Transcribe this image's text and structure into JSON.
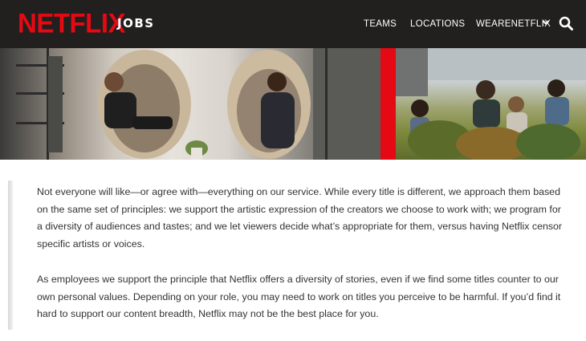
{
  "header": {
    "logo": "NETFLIX",
    "section": "JOBS",
    "nav": {
      "teams": "TEAMS",
      "locations": "LOCATIONS",
      "wearenetflix": "WEARENETFLIX"
    },
    "icons": {
      "dropdown": "chevron-down-icon",
      "search": "search-icon"
    }
  },
  "colors": {
    "brand_red": "#e50914",
    "header_bg": "#221f1f",
    "body_text": "#333333"
  },
  "content": {
    "paragraph_1": "Not everyone will like—or agree with—everything on our service. While every title is different, we approach them based on the same set of principles: we support the artistic expression of the creators we choose to work with; we program for a diversity of audiences and tastes; and we let viewers decide what’s appropriate for them, versus having Netflix censor specific artists or voices.",
    "paragraph_2": "As employees we support the principle that Netflix offers a diversity of stories, even if we find some titles counter to our own personal values. Depending on your role, you may need to work on titles you perceive to be harmful. If you’d find it hard to support our content breadth, Netflix may not be the best place for you."
  }
}
